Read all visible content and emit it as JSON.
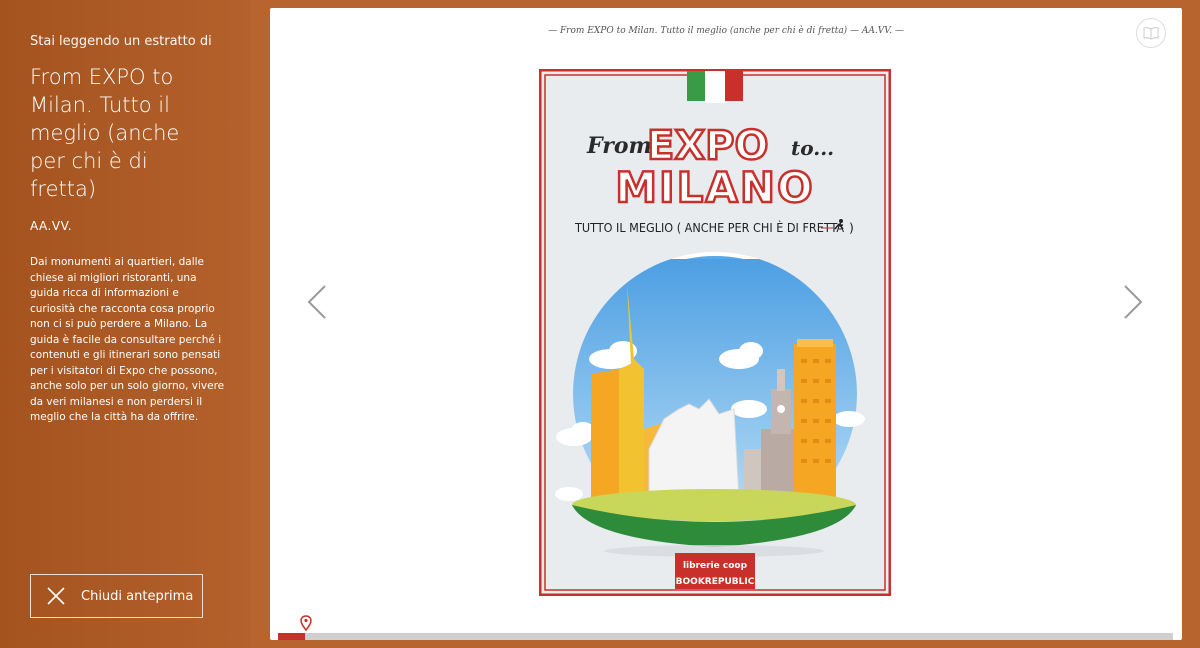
{
  "sidebar": {
    "kicker": "Stai leggendo un estratto di",
    "title": "From EXPO to Milan. Tutto il meglio (anche per chi è di fretta)",
    "author": "AA.VV.",
    "description": "Dai monumenti ai quartieri, dalle chiese ai migliori ristoranti, una guida ricca di informazioni e curiosità che racconta cosa proprio non ci si può perdere a Milano. La guida è facile da consultare perché i contenuti e gli itinerari sono pensati per i visitatori di Expo che possono, anche solo per un solo giorno, vivere da veri milanesi e non perdersi il meglio che la città ha da offrire.",
    "close_label": "Chiudi anteprima"
  },
  "reader": {
    "running_head": "— From EXPO to Milan. Tutto il meglio (anche per chi è di fretta) — AA.VV. —",
    "progress_fraction": 0.03
  },
  "cover": {
    "line1_small": "From",
    "line1_big": "EXPO",
    "line1_tail": "to...",
    "line2": "MILANO",
    "subtitle": "TUTTO IL MEGLIO ( ANCHE PER CHI È DI FRETTA",
    "subtitle_close": ")",
    "badge_top": "librerie coop",
    "badge_bottom": "BOOKREPUBLIC"
  },
  "colors": {
    "accent": "#b8642e",
    "cover_red": "#c9302c",
    "sky": "#5aa8e6"
  }
}
